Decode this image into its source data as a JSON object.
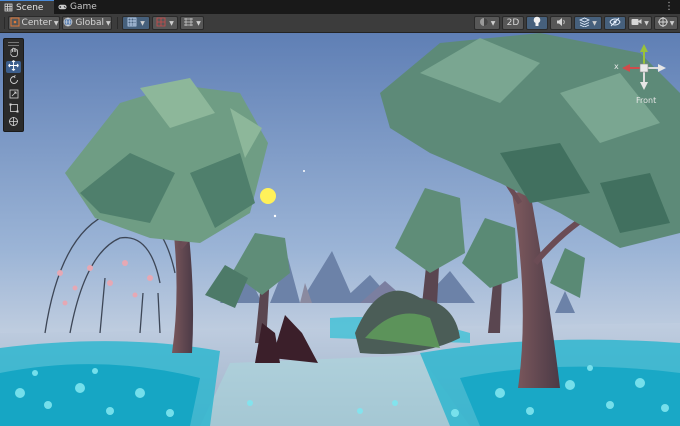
{
  "tabs": [
    {
      "label": "Scene",
      "icon": "grid-icon",
      "active": true
    },
    {
      "label": "Game",
      "icon": "gamepad-icon",
      "active": false
    }
  ],
  "toolbar": {
    "pivot_label": "Center",
    "space_label": "Global",
    "view_2d_label": "2D"
  },
  "gizmo": {
    "view_label": "Front",
    "axis_x_label": "x"
  },
  "colors": {
    "selected_tool": "#3c5e8c",
    "toolbar_bg": "#3c3c3c",
    "accent": "#4a8ad8"
  }
}
